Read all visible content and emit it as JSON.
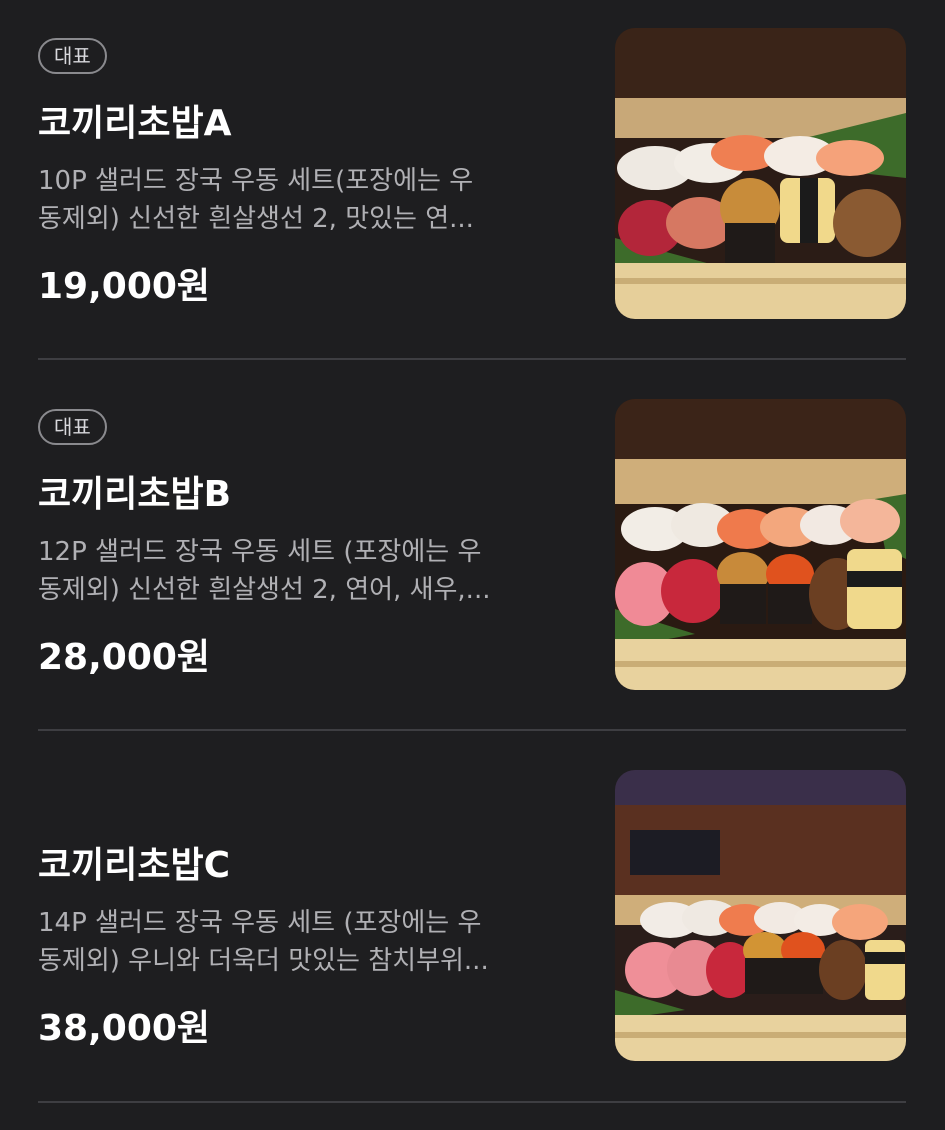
{
  "menu": {
    "items": [
      {
        "badge": "대표",
        "name": "코끼리초밥A",
        "desc_line1": "10P 샐러드 장국 우동 세트(포장에는 우",
        "desc_line2": "동제외) 신선한 흰살생선 2, 맛있는 연...",
        "price": "19,000원",
        "image_icon": "sushi-platter-photo"
      },
      {
        "badge": "대표",
        "name": "코끼리초밥B",
        "desc_line1": "12P 샐러드 장국 우동 세트 (포장에는 우",
        "desc_line2": "동제외) 신선한 흰살생선 2, 연어, 새우,...",
        "price": "28,000원",
        "image_icon": "sushi-platter-photo"
      },
      {
        "badge": "",
        "name": "코끼리초밥C",
        "desc_line1": "14P 샐러드 장국 우동 세트 (포장에는 우",
        "desc_line2": "동제외) 우니와 더욱더 맛있는 참치부위...",
        "price": "38,000원",
        "image_icon": "sushi-platter-photo"
      }
    ]
  },
  "colors": {
    "background": "#1e1e20",
    "text_primary": "#ffffff",
    "text_secondary": "#b0b0b4",
    "badge_border": "#8a8a8e",
    "divider": "#3e3e42"
  }
}
